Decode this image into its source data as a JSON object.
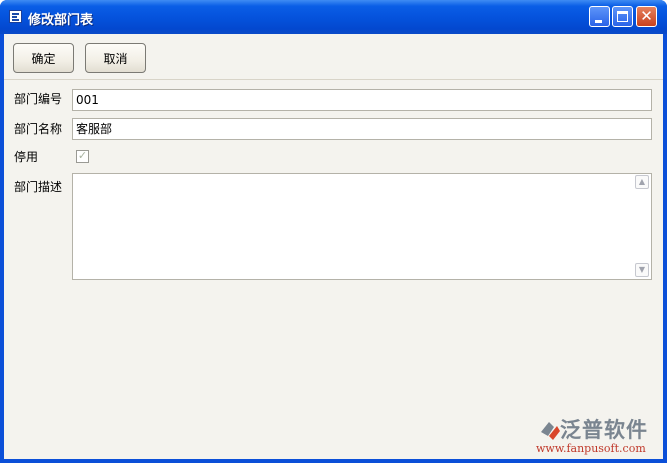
{
  "window": {
    "title": "修改部门表",
    "controls": {
      "minimize_icon": "minimize-icon",
      "maximize_icon": "maximize-icon",
      "close_icon": "close-icon",
      "close_glyph": "✕"
    }
  },
  "toolbar": {
    "confirm_label": "确定",
    "cancel_label": "取消"
  },
  "form": {
    "dept_code": {
      "label": "部门编号",
      "value": "001"
    },
    "dept_name": {
      "label": "部门名称",
      "value": "客服部"
    },
    "disabled": {
      "label": "停用",
      "checked": true,
      "check_glyph": "✓"
    },
    "description": {
      "label": "部门描述",
      "value": "",
      "scroll_up": "▲",
      "scroll_down": "▼"
    }
  },
  "watermark": {
    "brand_text": "泛普软件",
    "url": "www.fanpusoft.com"
  },
  "colors": {
    "titlebar": "#0553dd",
    "client_bg": "#f4f3ee",
    "close_button": "#c8411e",
    "url_red": "#c0392b"
  }
}
